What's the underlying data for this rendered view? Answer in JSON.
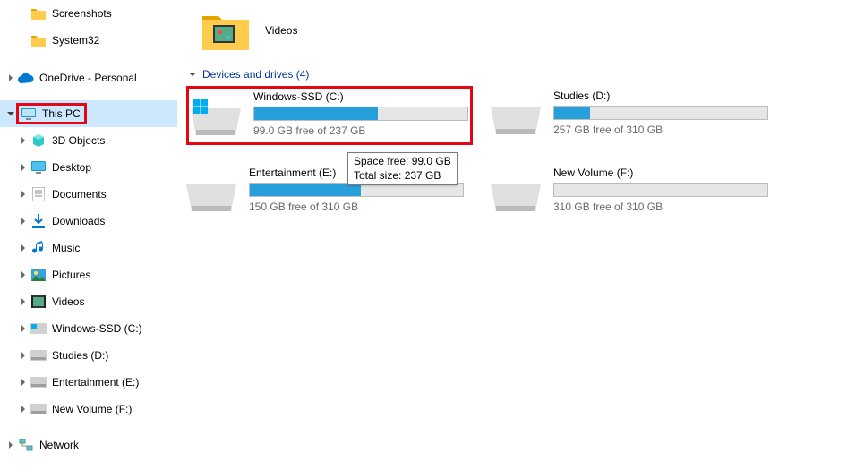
{
  "sidebar": {
    "top": [
      {
        "label": "Screenshots"
      },
      {
        "label": "System32"
      }
    ],
    "onedrive_label": "OneDrive - Personal",
    "thispc_label": "This PC",
    "thispc_children": [
      {
        "label": "3D Objects"
      },
      {
        "label": "Desktop"
      },
      {
        "label": "Documents"
      },
      {
        "label": "Downloads"
      },
      {
        "label": "Music"
      },
      {
        "label": "Pictures"
      },
      {
        "label": "Videos"
      },
      {
        "label": "Windows-SSD (C:)"
      },
      {
        "label": "Studies (D:)"
      },
      {
        "label": "Entertainment (E:)"
      },
      {
        "label": "New Volume (F:)"
      }
    ],
    "network_label": "Network"
  },
  "main": {
    "videos_label": "Videos",
    "section_label": "Devices and drives (4)",
    "drives": [
      {
        "name": "Windows-SSD (C:)",
        "free": "99.0 GB free of 237 GB",
        "fill_pct": 58
      },
      {
        "name": "Studies (D:)",
        "free": "257 GB free of 310 GB",
        "fill_pct": 17
      },
      {
        "name": "Entertainment (E:)",
        "free": "150 GB free of 310 GB",
        "fill_pct": 52
      },
      {
        "name": "New Volume (F:)",
        "free": "310 GB free of 310 GB",
        "fill_pct": 0
      }
    ],
    "tooltip": {
      "line1": "Space free: 99.0 GB",
      "line2": "Total size: 237 GB"
    }
  }
}
